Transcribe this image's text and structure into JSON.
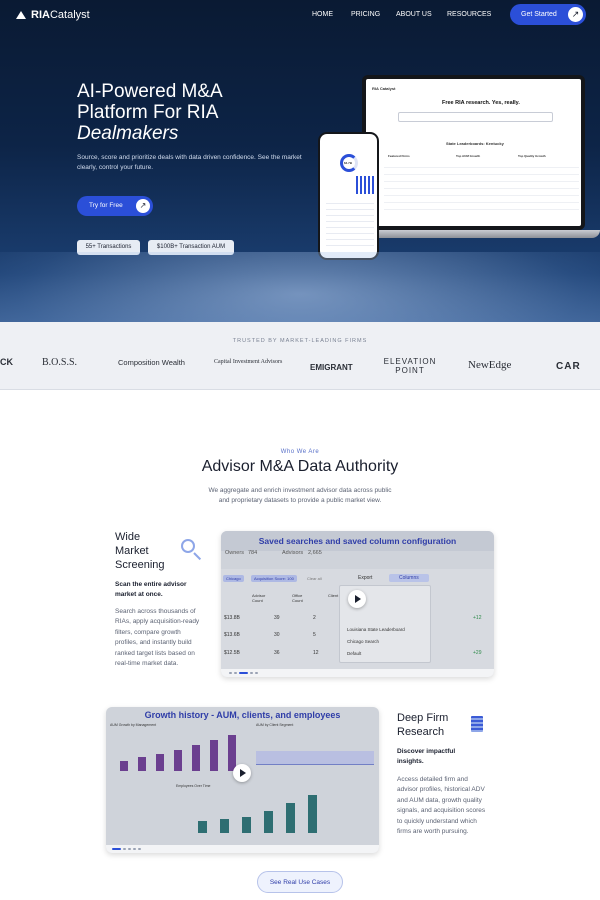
{
  "nav": {
    "logo_bold": "RIA",
    "logo_rest": "Catalyst",
    "links": [
      "HOME",
      "PRICING",
      "ABOUT US",
      "RESOURCES"
    ],
    "cta": "Get Started"
  },
  "hero": {
    "title_line1": "AI-Powered M&A",
    "title_line2": "Platform For RIA",
    "title_line3": "Dealmakers",
    "subtitle": "Source, score and prioritize deals with data driven confidence. See the market clearly, control your future.",
    "cta": "Try for Free",
    "chips": [
      "55+ Transactions",
      "$100B+ Transaction AUM"
    ],
    "laptop": {
      "brand": "RIA Catalyst",
      "headline": "Free RIA research. Yes, really.",
      "section": "State Leaderboards: Kentucky",
      "col1": "Featured Firms",
      "col2": "Top AUM Growth",
      "col3": "Top Quality Growth"
    },
    "phone": {
      "score": "$4.7B"
    }
  },
  "trusted": {
    "label": "TRUSTED BY MARKET-LEADING FIRMS",
    "brands": [
      "CK",
      "B.O.S.S.",
      "Composition Wealth",
      "Capital Investment Advisors",
      "EMIGRANT",
      "ELEVATION POINT",
      "NewEdge",
      "CAR"
    ]
  },
  "about": {
    "eyebrow": "Who We Are",
    "title": "Advisor M&A Data Authority",
    "subtitle_line1": "We aggregate and enrich investment advisor data across public",
    "subtitle_line2": "and proprietary datasets to provide a public market view."
  },
  "feature1": {
    "title_line1": "Wide",
    "title_line2": "Market",
    "title_line3": "Screening",
    "bold": "Scan the entire advisor market at once.",
    "text": "Search across thousands of RIAs, apply acquisition-ready filters, compare growth profiles, and instantly build ranked target lists based on real-time market data.",
    "caption": "Saved searches and saved column configuration",
    "table": {
      "owners_label": "Owners",
      "owners_val": "784",
      "advisors_label": "Advisors",
      "advisors_val": "2,665",
      "filter1": "Chicago",
      "filter2": "Acquisition Score: 100",
      "clear": "Clear all",
      "export": "Export",
      "columns": "Columns",
      "col_advisor": "Advisor Count",
      "col_office": "Office Count",
      "col_client": "Client",
      "rows": [
        {
          "aum": "$13.8B",
          "adv": "39",
          "off": "2"
        },
        {
          "aum": "$13.6B",
          "adv": "30",
          "off": "5"
        },
        {
          "aum": "$12.5B",
          "adv": "36",
          "off": "12"
        }
      ],
      "saved": [
        "Louisiana State Leaderboard",
        "Chicago Search",
        "Default"
      ],
      "growth": [
        "+12",
        "+29"
      ]
    }
  },
  "feature2": {
    "title_line1": "Deep Firm",
    "title_line2": "Research",
    "bold": "Discover impactful insights.",
    "text": "Access detailed firm and advisor profiles, historical ADV and AUM data, growth quality signals, and acquisition scores to quickly understand which firms are worth pursuing.",
    "caption": "Growth history - AUM, clients, and employees",
    "chart1_label": "AUM Growth by Management",
    "chart2_label": "AUM by Client Segment",
    "chart3_label": "Employees Over Time"
  },
  "cta": {
    "label": "See Real Use Cases"
  },
  "colors": {
    "accent": "#2b4fd8",
    "hero_dark": "#0a1a33",
    "purple_bar": "#6b3f8f",
    "teal_bar": "#2e6e72"
  }
}
